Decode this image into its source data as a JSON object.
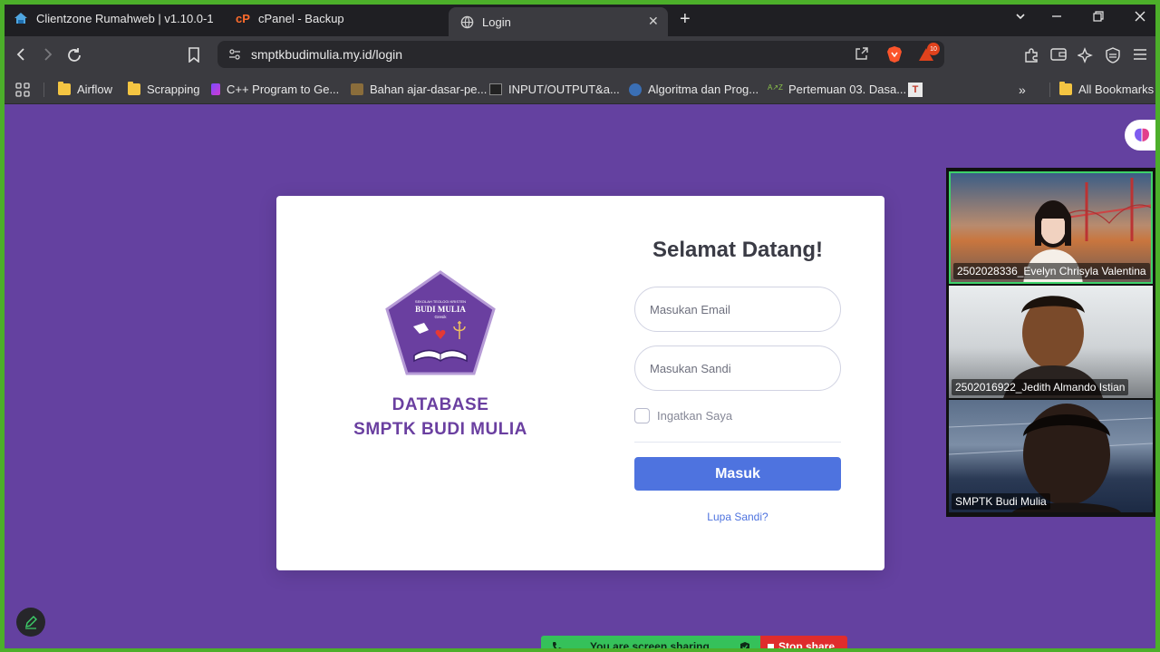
{
  "browser": {
    "tabs": [
      {
        "title": "Clientzone Rumahweb | v1.10.0-1",
        "icon": "rumahweb-icon",
        "active": false
      },
      {
        "title": "cPanel - Backup",
        "icon": "cpanel-icon",
        "active": false
      },
      {
        "title": "Login",
        "icon": "globe-icon",
        "active": true
      }
    ],
    "url": "smptkbudimulia.my.id/login",
    "rewards_badge": "10",
    "bookmarks": [
      {
        "label": "Airflow",
        "icon": "folder-icon"
      },
      {
        "label": "Scrapping",
        "icon": "folder-icon"
      },
      {
        "label": "C++ Program to Ge...",
        "icon": "cpp-icon"
      },
      {
        "label": "Bahan ajar-dasar-pe...",
        "icon": "book-icon"
      },
      {
        "label": "INPUT/OUTPUT&a...",
        "icon": "io-icon"
      },
      {
        "label": "Algoritma dan Prog...",
        "icon": "wordpress-icon"
      },
      {
        "label": "Pertemuan 03. Dasa...",
        "icon": "anz-icon"
      },
      {
        "label": "",
        "icon": "t-icon"
      }
    ],
    "all_bookmarks": "All Bookmarks"
  },
  "login": {
    "logo_small_text": "SEKOLAH TEOLOGI KRISTEN",
    "logo_name": "BUDI MULIA",
    "logo_city": "Gresik",
    "db_title_line1": "DATABASE",
    "db_title_line2": "SMPTK BUDI MULIA",
    "welcome": "Selamat Datang!",
    "email_placeholder": "Masukan Email",
    "password_placeholder": "Masukan Sandi",
    "remember_label": "Ingatkan Saya",
    "submit_label": "Masuk",
    "forgot_label": "Lupa Sandi?"
  },
  "meeting": {
    "participants": [
      {
        "name": "2502028336_Evelyn Chrisyla Valentina",
        "active_speaker": true
      },
      {
        "name": "2502016922_Jedith Almando Istian",
        "active_speaker": false
      },
      {
        "name": "SMPTK Budi Mulia",
        "active_speaker": false
      }
    ],
    "sharing_text": "You are screen sharing",
    "stop_label": "Stop share"
  },
  "colors": {
    "page_bg": "#6441a0",
    "primary": "#4e73df",
    "brand_purple": "#6a3fa0",
    "share_green": "#35c15a",
    "stop_red": "#e02c2c"
  }
}
